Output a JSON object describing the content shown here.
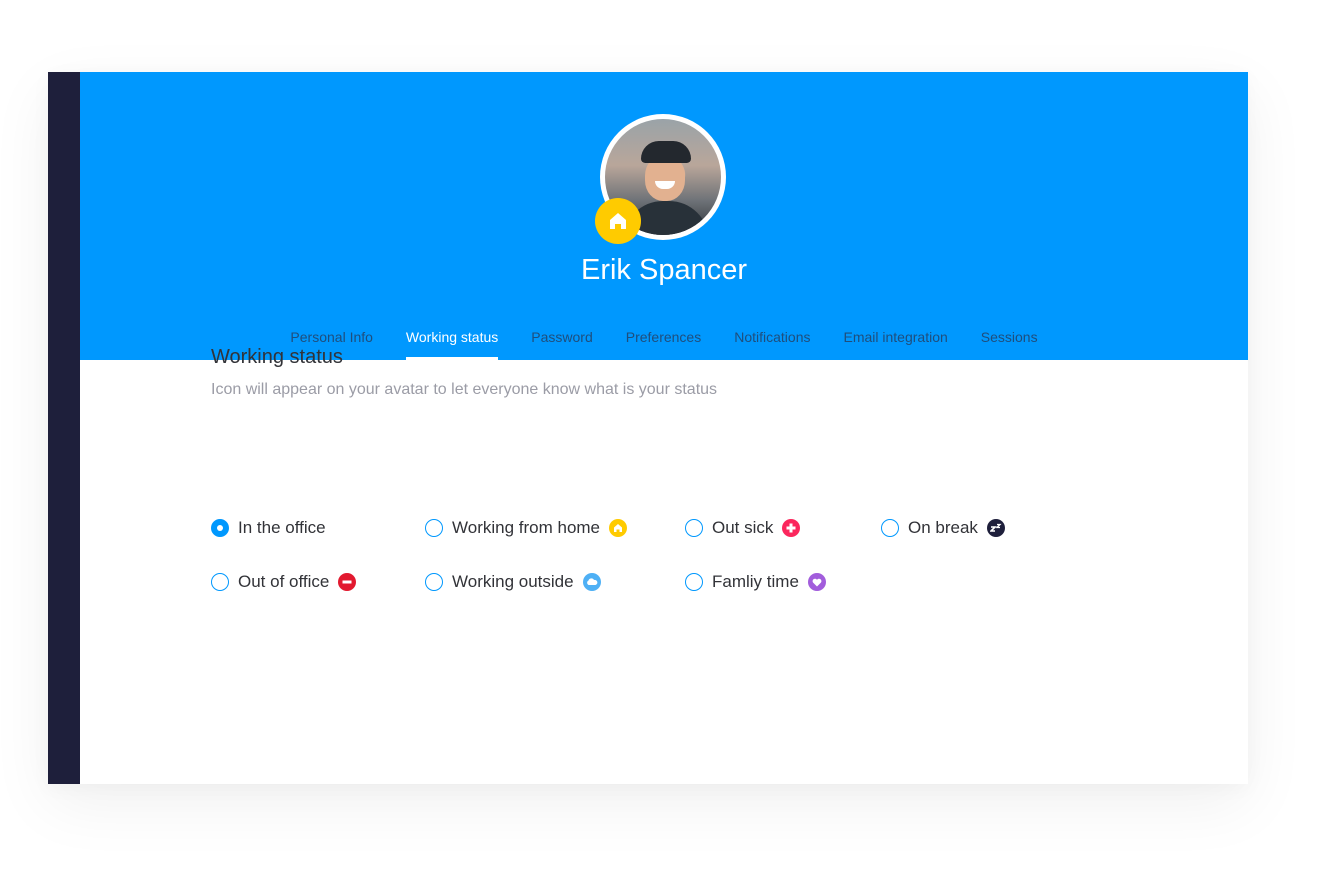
{
  "profile": {
    "name": "Erik Spancer",
    "current_status_icon": "home-icon",
    "current_status_color": "#ffcb00"
  },
  "tabs": [
    {
      "label": "Personal Info",
      "active": false
    },
    {
      "label": "Working status",
      "active": true
    },
    {
      "label": "Password",
      "active": false
    },
    {
      "label": "Preferences",
      "active": false
    },
    {
      "label": "Notifications",
      "active": false
    },
    {
      "label": "Email integration",
      "active": false
    },
    {
      "label": "Sessions",
      "active": false
    }
  ],
  "section": {
    "title": "Working status",
    "subtitle": "Icon will appear on your avatar to let everyone know what is your status"
  },
  "options": [
    {
      "label": "In the office",
      "checked": true,
      "icon": null,
      "color": null
    },
    {
      "label": "Working from home",
      "checked": false,
      "icon": "home-icon",
      "color": "#ffcb00"
    },
    {
      "label": "Out sick",
      "checked": false,
      "icon": "plus-icon",
      "color": "#fb275d"
    },
    {
      "label": "On break",
      "checked": false,
      "icon": "sleep-icon",
      "color": "#1e1f3b"
    },
    {
      "label": "Out of office",
      "checked": false,
      "icon": "minus-icon",
      "color": "#e2192f"
    },
    {
      "label": "Working outside",
      "checked": false,
      "icon": "cloud-icon",
      "color": "#4eb0f5"
    },
    {
      "label": "Famliy time",
      "checked": false,
      "icon": "heart-icon",
      "color": "#a25ddc"
    }
  ],
  "colors": {
    "header": "#0098fe",
    "sidebar": "#1e1f3b",
    "radio": "#0098fe"
  }
}
